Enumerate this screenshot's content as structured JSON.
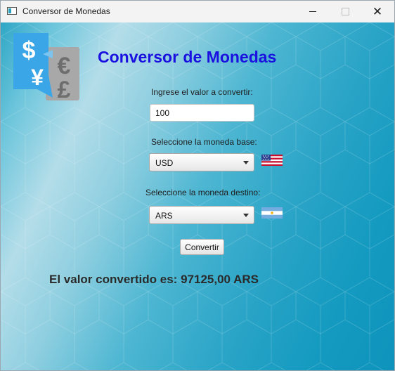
{
  "window": {
    "title": "Conversor de Monedas",
    "minimize_symbol": "",
    "close_symbol": "✕"
  },
  "colors": {
    "heading": "#1a10e0",
    "background_accent": "#149ac0",
    "logo_blue": "#3aa6e8",
    "logo_gray": "#9e9e9e"
  },
  "logo": {
    "symbols": [
      "$",
      "¥",
      "€",
      "£"
    ]
  },
  "heading": "Conversor de Monedas",
  "form": {
    "amount_label": "Ingrese el valor a convertir:",
    "amount_value": "100",
    "base_label": "Seleccione la moneda base:",
    "base_selected": "USD",
    "base_flag_icon": "us-flag-icon",
    "target_label": "Seleccione la moneda destino:",
    "target_selected": "ARS",
    "target_flag_icon": "argentina-flag-icon",
    "convert_label": "Convertir"
  },
  "result": {
    "prefix": "El valor convertido es:",
    "value": "97125,00",
    "currency": "ARS"
  }
}
